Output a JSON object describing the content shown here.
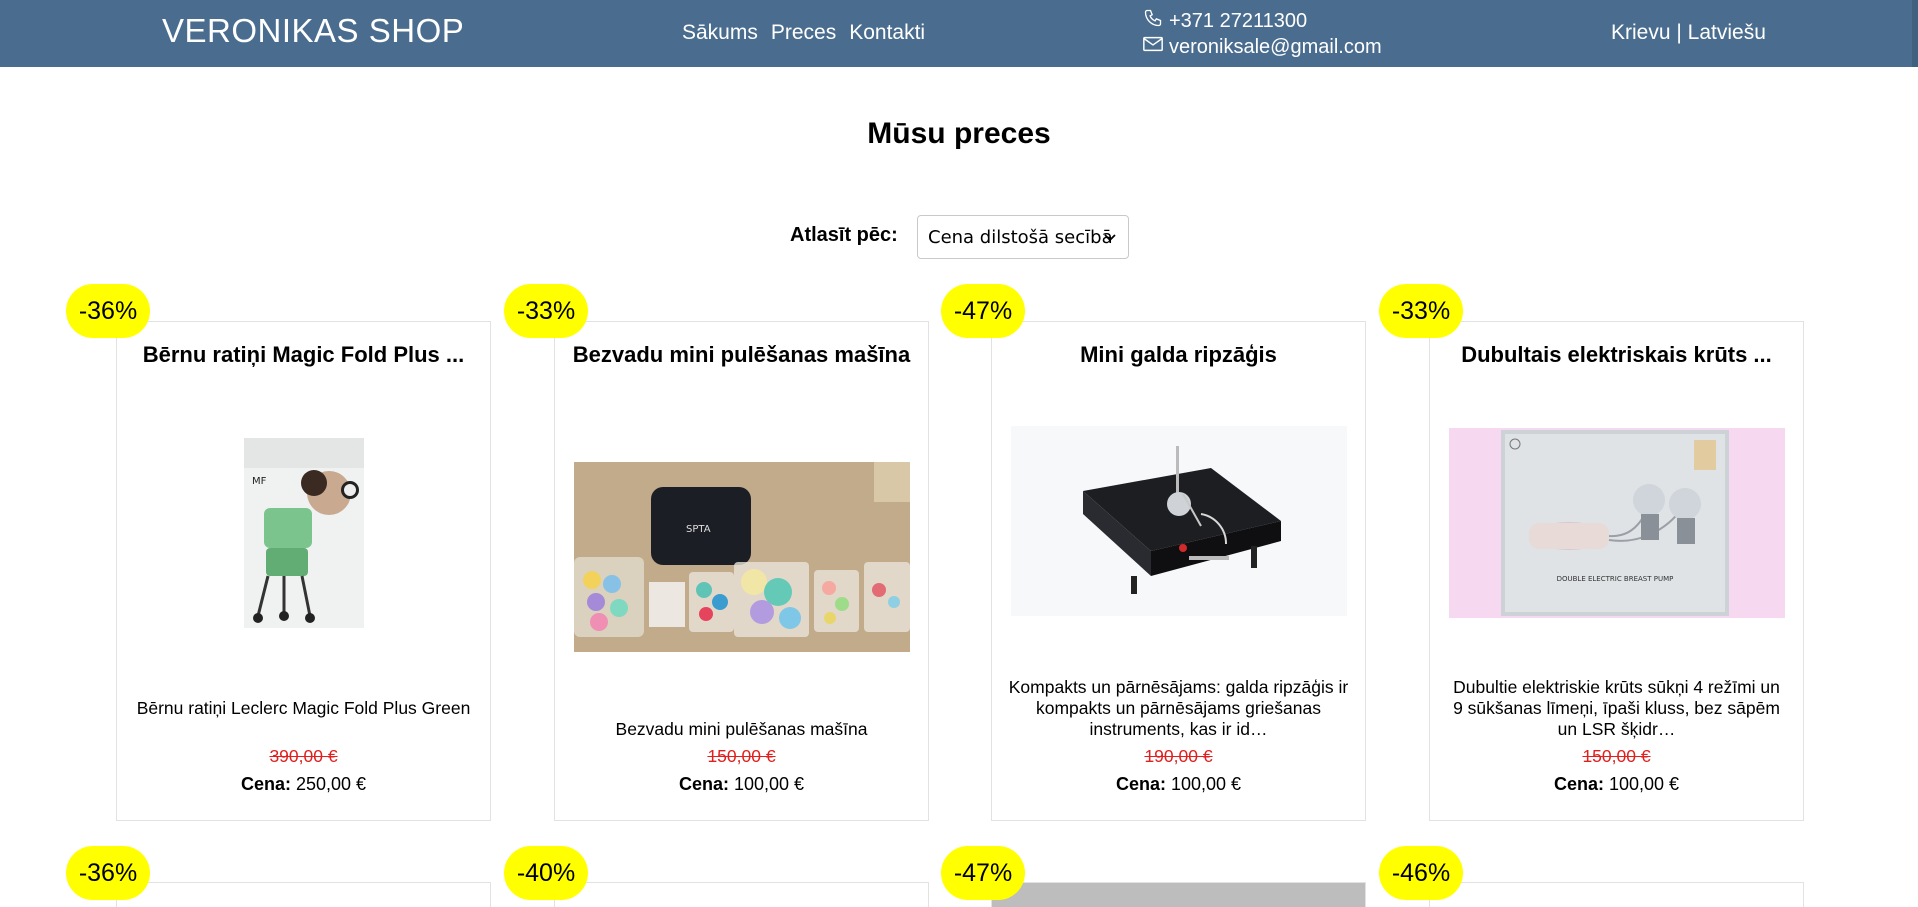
{
  "header": {
    "brand": "VERONIKAS SHOP",
    "nav": [
      "Sākums",
      "Preces",
      "Kontakti"
    ],
    "phone": "+371 27211300",
    "email": "veroniksale@gmail.com",
    "lang_ru": "Krievu",
    "lang_sep": " | ",
    "lang_lv": "Latviešu",
    "bg_color": "#4a6d8f"
  },
  "main": {
    "title": "Mūsu preces",
    "sort_label": "Atlasīt pēc:",
    "sort_value": "Cena dilstošā secībā"
  },
  "products": [
    {
      "badge": "-36%",
      "title": "Bērnu ratiņi Magic Fold Plus ...",
      "description": "Bērnu ratiņi Leclerc Magic Fold Plus Green",
      "old_price": "390,00 €",
      "price_label": "Cena:",
      "price": " 250,00 €"
    },
    {
      "badge": "-33%",
      "title": "Bezvadu mini pulēšanas mašīna",
      "description": "Bezvadu mini pulēšanas mašīna",
      "old_price": "150,00 €",
      "price_label": "Cena:",
      "price": " 100,00 €"
    },
    {
      "badge": "-47%",
      "title": "Mini galda ripzāģis",
      "description": "Kompakts un pārnēsājams: galda ripzāģis ir kompakts un pārnēsājams griešanas instruments, kas ir id…",
      "old_price": "190,00 €",
      "price_label": "Cena:",
      "price": " 100,00 €"
    },
    {
      "badge": "-33%",
      "title": "Dubultais elektriskais krūts ...",
      "description": "Dubultie elektriskie krūts sūkņi 4 režīmi un 9 sūkšanas līmeņi, īpaši kluss, bez sāpēm un LSR šķidr…",
      "old_price": "150,00 €",
      "price_label": "Cena:",
      "price": " 100,00 €",
      "image_text": "DOUBLE ELECTRIC BREAST PUMP"
    }
  ],
  "next_row_badges": [
    "-36%",
    "-40%",
    "-47%",
    "-46%"
  ],
  "colors": {
    "badge": "#ffff00",
    "old_price": "#e0201e"
  }
}
